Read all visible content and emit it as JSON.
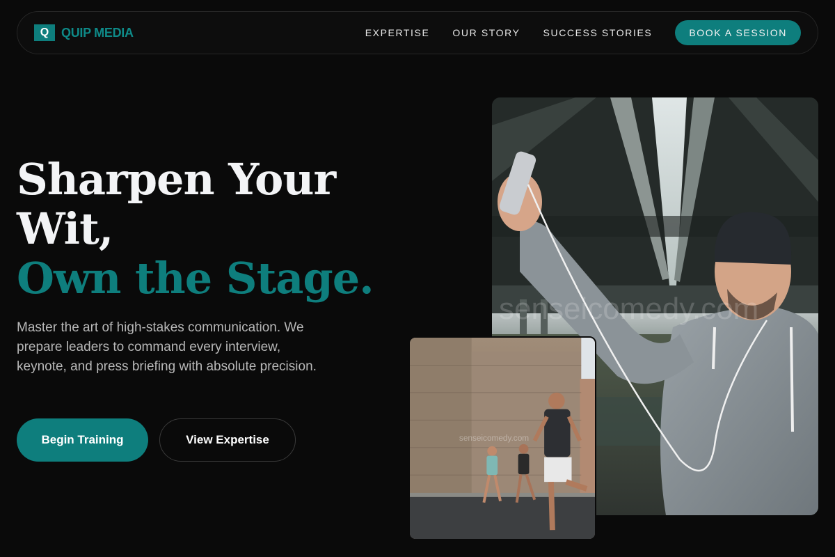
{
  "brand": {
    "mark": "Q",
    "name": "QUIP MEDIA",
    "accent": "#0e7e7d"
  },
  "nav": {
    "links": [
      "EXPERTISE",
      "OUR STORY",
      "SUCCESS STORIES"
    ],
    "cta": "BOOK A SESSION"
  },
  "hero": {
    "title_line1": "Sharpen Your",
    "title_line2": "Wit,",
    "title_line3": "Own the Stage.",
    "subtitle": "Master the art of high-stakes communication. We prepare leaders to command every interview, keynote, and press briefing with absolute precision.",
    "primary_button": "Begin Training",
    "secondary_button": "View Expertise"
  },
  "images": {
    "main_watermark": "senseicomedy.com",
    "small_watermark": "senseicomedy.com"
  }
}
